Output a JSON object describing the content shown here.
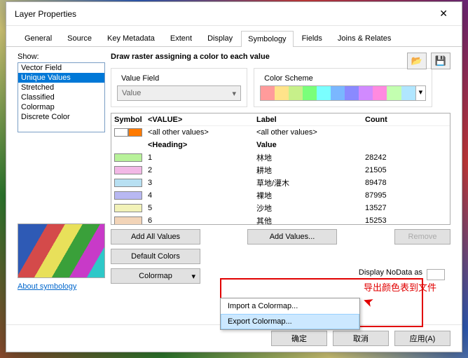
{
  "window_title": "Layer Properties",
  "tabs": [
    "General",
    "Source",
    "Key Metadata",
    "Extent",
    "Display",
    "Symbology",
    "Fields",
    "Joins & Relates"
  ],
  "active_tab": "Symbology",
  "show_label": "Show:",
  "show_list": [
    "Vector Field",
    "Unique Values",
    "Stretched",
    "Classified",
    "Colormap",
    "Discrete Color"
  ],
  "show_selected": "Unique Values",
  "about_link": "About symbology",
  "main_heading": "Draw raster assigning a color to each value",
  "vf_title": "Value Field",
  "vf_value": "Value",
  "cs_title": "Color Scheme",
  "cs_colors": [
    "#ff9b9b",
    "#ffe38a",
    "#c7f08a",
    "#7aff7a",
    "#7affff",
    "#7ab7ff",
    "#8a8aff",
    "#d18aff",
    "#ff8ae0",
    "#c3ffb0",
    "#b0e6ff"
  ],
  "grid_headers": {
    "symbol": "Symbol",
    "value": "<VALUE>",
    "label": "Label",
    "count": "Count"
  },
  "all_other": {
    "value": "<all other values>",
    "label": "<all other values>",
    "c1": "#ffffff",
    "c2": "#ff7a00"
  },
  "heading_row": {
    "value": "<Heading>",
    "label": "Value"
  },
  "rows": [
    {
      "sym": "#b8f29a",
      "value": "1",
      "label": "林地",
      "count": "28242"
    },
    {
      "sym": "#f2b8e6",
      "value": "2",
      "label": "耕地",
      "count": "21505"
    },
    {
      "sym": "#b8e0f2",
      "value": "3",
      "label": "草地/灌木",
      "count": "89478"
    },
    {
      "sym": "#b8b8f2",
      "value": "4",
      "label": "裸地",
      "count": "87995"
    },
    {
      "sym": "#f2f2b8",
      "value": "5",
      "label": "沙地",
      "count": "13527"
    },
    {
      "sym": "#f2d4b8",
      "value": "6",
      "label": "其他",
      "count": "15253"
    }
  ],
  "buttons": {
    "add_all": "Add All Values",
    "add": "Add Values...",
    "remove": "Remove",
    "default_colors": "Default Colors",
    "colormap": "Colormap"
  },
  "menu": {
    "import": "Import a Colormap...",
    "export": "Export Colormap..."
  },
  "nodata": "Display NoData as",
  "annotation": "导出颜色表到文件",
  "footer": {
    "ok": "确定",
    "cancel": "取消",
    "apply": "应用(A)"
  }
}
